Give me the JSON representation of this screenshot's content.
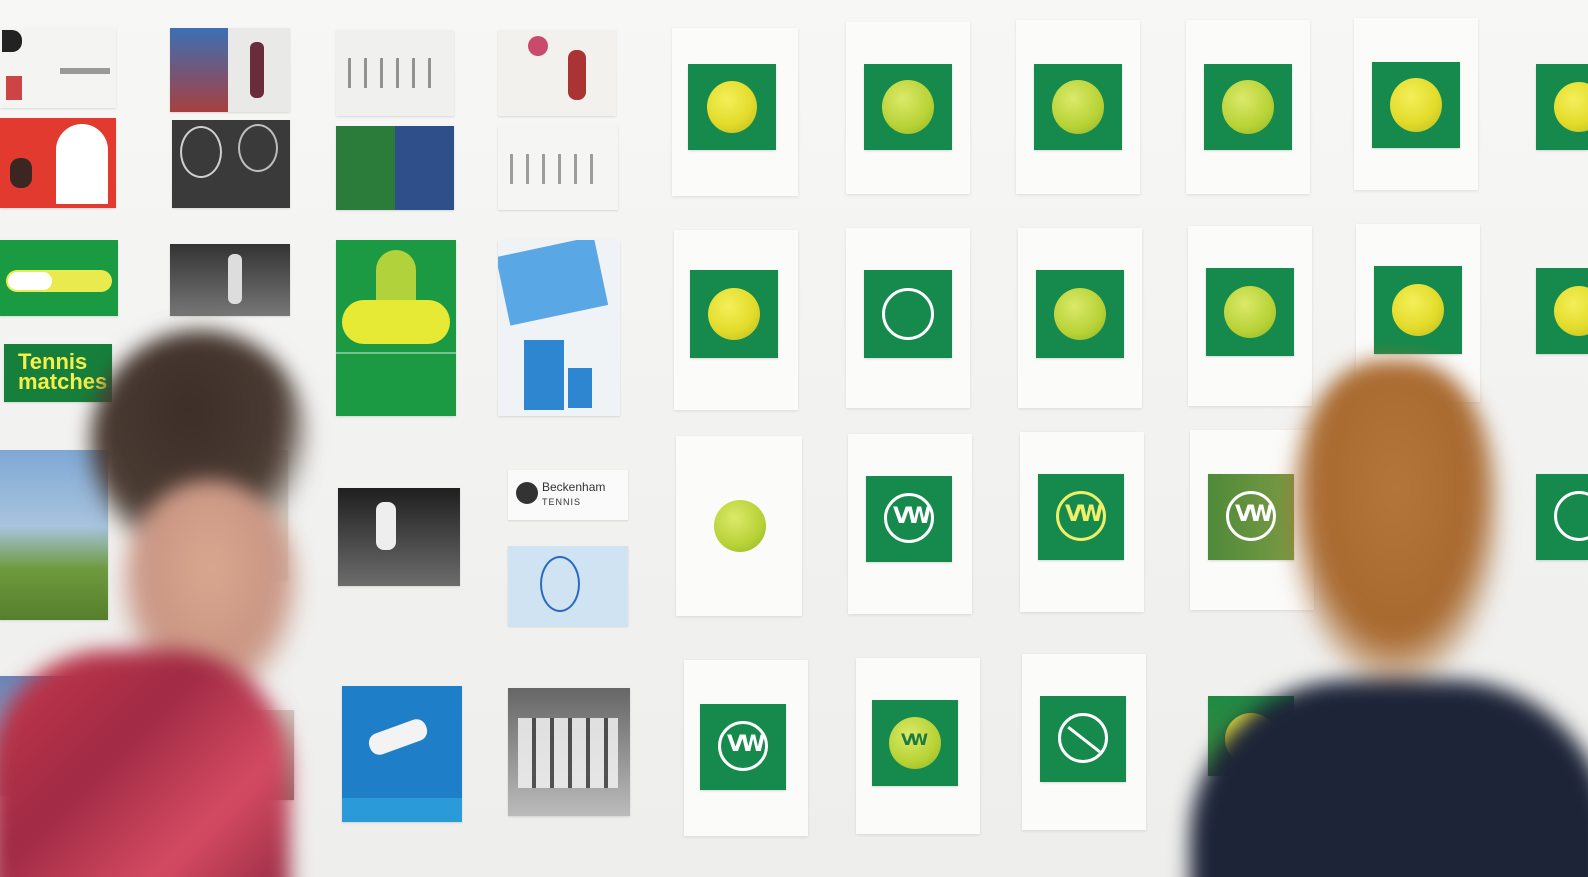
{
  "scene": {
    "description_none": "",
    "posters": {
      "tennis_matches_text_line1": "Tennis",
      "tennis_matches_text_line2": "matches",
      "brand_card_text": "Beckenham",
      "brand_card_sub": "TENNIS"
    },
    "colors": {
      "brand_green": "#168a4c",
      "ball_yellow": "#e3dc2c",
      "wall": "#f4f4f2"
    }
  }
}
